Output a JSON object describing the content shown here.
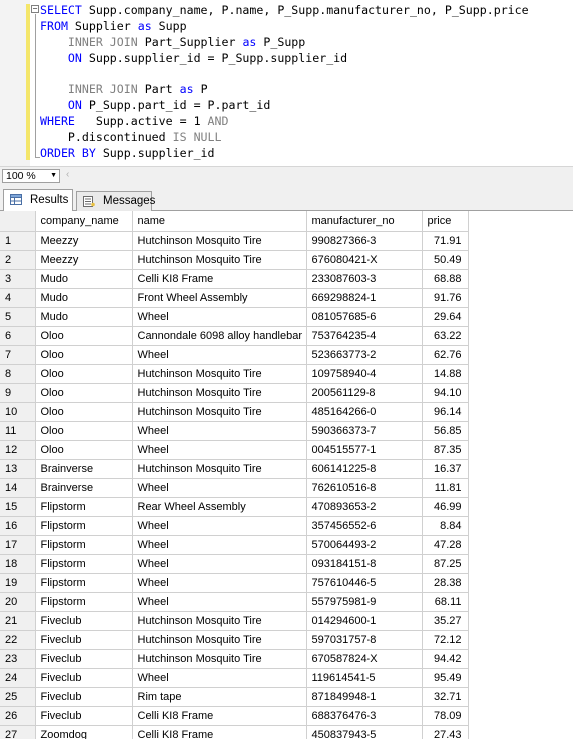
{
  "editor": {
    "lines": [
      [
        {
          "t": "SELECT",
          "c": "kw"
        },
        {
          "t": " Supp.company_name, P.name, P_Supp.manufacturer_no, P_Supp.price",
          "c": ""
        }
      ],
      [
        {
          "t": "FROM",
          "c": "kw"
        },
        {
          "t": " Supplier ",
          "c": ""
        },
        {
          "t": "as",
          "c": "kw"
        },
        {
          "t": " Supp",
          "c": ""
        }
      ],
      [
        {
          "t": "    INNER JOIN",
          "c": "gray"
        },
        {
          "t": " Part_Supplier ",
          "c": ""
        },
        {
          "t": "as",
          "c": "kw"
        },
        {
          "t": " P_Supp",
          "c": ""
        }
      ],
      [
        {
          "t": "    ON",
          "c": "kw"
        },
        {
          "t": " Supp.supplier_id = P_Supp.supplier_id",
          "c": ""
        }
      ],
      [
        {
          "t": "",
          "c": ""
        }
      ],
      [
        {
          "t": "    INNER JOIN",
          "c": "gray"
        },
        {
          "t": " Part ",
          "c": ""
        },
        {
          "t": "as",
          "c": "kw"
        },
        {
          "t": " P",
          "c": ""
        }
      ],
      [
        {
          "t": "    ON",
          "c": "kw"
        },
        {
          "t": " P_Supp.part_id = P.part_id",
          "c": ""
        }
      ],
      [
        {
          "t": "WHERE",
          "c": "kw"
        },
        {
          "t": "   Supp.active = 1 ",
          "c": ""
        },
        {
          "t": "AND",
          "c": "gray"
        }
      ],
      [
        {
          "t": "    P.discontinued ",
          "c": ""
        },
        {
          "t": "IS NULL",
          "c": "gray"
        }
      ],
      [
        {
          "t": "ORDER BY",
          "c": "kw"
        },
        {
          "t": " Supp.supplier_id",
          "c": ""
        }
      ]
    ]
  },
  "zoom": {
    "value": "100 %"
  },
  "tabs": {
    "results": "Results",
    "messages": "Messages"
  },
  "grid": {
    "columns": [
      "company_name",
      "name",
      "manufacturer_no",
      "price"
    ],
    "rows": [
      [
        "1",
        "Meezzy",
        "Hutchinson Mosquito Tire",
        "990827366-3",
        "71.91"
      ],
      [
        "2",
        "Meezzy",
        "Hutchinson Mosquito Tire",
        "676080421-X",
        "50.49"
      ],
      [
        "3",
        "Mudo",
        "Celli KI8 Frame",
        "233087603-3",
        "68.88"
      ],
      [
        "4",
        "Mudo",
        "Front Wheel Assembly",
        "669298824-1",
        "91.76"
      ],
      [
        "5",
        "Mudo",
        "Wheel",
        "081057685-6",
        "29.64"
      ],
      [
        "6",
        "Oloo",
        "Cannondale 6098 alloy handlebar",
        "753764235-4",
        "63.22"
      ],
      [
        "7",
        "Oloo",
        "Wheel",
        "523663773-2",
        "62.76"
      ],
      [
        "8",
        "Oloo",
        "Hutchinson Mosquito Tire",
        "109758940-4",
        "14.88"
      ],
      [
        "9",
        "Oloo",
        "Hutchinson Mosquito Tire",
        "200561129-8",
        "94.10"
      ],
      [
        "10",
        "Oloo",
        "Hutchinson Mosquito Tire",
        "485164266-0",
        "96.14"
      ],
      [
        "11",
        "Oloo",
        "Wheel",
        "590366373-7",
        "56.85"
      ],
      [
        "12",
        "Oloo",
        "Wheel",
        "004515577-1",
        "87.35"
      ],
      [
        "13",
        "Brainverse",
        "Hutchinson Mosquito Tire",
        "606141225-8",
        "16.37"
      ],
      [
        "14",
        "Brainverse",
        "Wheel",
        "762610516-8",
        "11.81"
      ],
      [
        "15",
        "Flipstorm",
        "Rear Wheel Assembly",
        "470893653-2",
        "46.99"
      ],
      [
        "16",
        "Flipstorm",
        "Wheel",
        "357456552-6",
        "8.84"
      ],
      [
        "17",
        "Flipstorm",
        "Wheel",
        "570064493-2",
        "47.28"
      ],
      [
        "18",
        "Flipstorm",
        "Wheel",
        "093184151-8",
        "87.25"
      ],
      [
        "19",
        "Flipstorm",
        "Wheel",
        "757610446-5",
        "28.38"
      ],
      [
        "20",
        "Flipstorm",
        "Wheel",
        "557975981-9",
        "68.11"
      ],
      [
        "21",
        "Fiveclub",
        "Hutchinson Mosquito Tire",
        "014294600-1",
        "35.27"
      ],
      [
        "22",
        "Fiveclub",
        "Hutchinson Mosquito Tire",
        "597031757-8",
        "72.12"
      ],
      [
        "23",
        "Fiveclub",
        "Hutchinson Mosquito Tire",
        "670587824-X",
        "94.42"
      ],
      [
        "24",
        "Fiveclub",
        "Wheel",
        "119614541-5",
        "95.49"
      ],
      [
        "25",
        "Fiveclub",
        "Rim tape",
        "871849948-1",
        "32.71"
      ],
      [
        "26",
        "Fiveclub",
        "Celli KI8 Frame",
        "688376476-3",
        "78.09"
      ],
      [
        "27",
        "Zoomdog",
        "Celli KI8 Frame",
        "450837943-5",
        "27.43"
      ]
    ]
  }
}
